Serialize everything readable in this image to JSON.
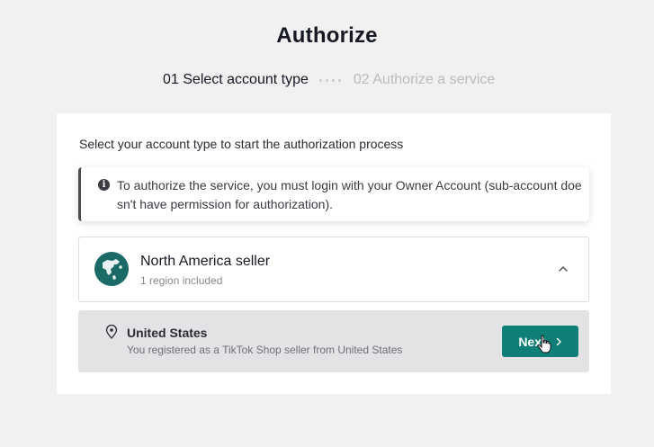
{
  "page": {
    "title": "Authorize"
  },
  "steps": [
    {
      "label": "01 Select account type",
      "active": true
    },
    {
      "label": "02 Authorize a service",
      "active": false
    }
  ],
  "card": {
    "heading": "Select your account type to start the authorization process",
    "notice": {
      "icon": "info-icon",
      "text": "To authorize the service, you must login with your Owner Account (sub-account doesn't have permission for authorization)."
    },
    "seller": {
      "icon": "globe-icon",
      "title": "North America seller",
      "subtitle": "1 region included",
      "expanded": true
    },
    "region": {
      "icon": "location-pin-icon",
      "title": "United States",
      "subtitle": "You registered as a TikTok Shop seller from United States",
      "button_label": "Next"
    }
  },
  "colors": {
    "accent": "#0d7f76",
    "background": "#f1f1f2",
    "region_bg": "#e3e3e5"
  }
}
